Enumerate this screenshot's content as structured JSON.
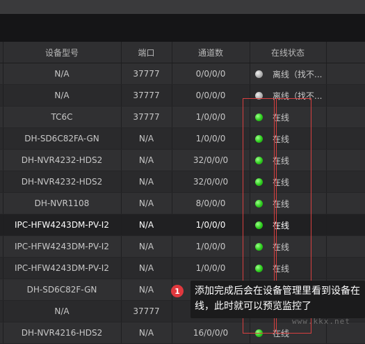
{
  "columns": [
    "设备型号",
    "端口",
    "通道数",
    "在线状态"
  ],
  "rows": [
    {
      "model": "N/A",
      "port": "37777",
      "channels": "0/0/0/0",
      "status": "离线（找不...",
      "online": false
    },
    {
      "model": "N/A",
      "port": "37777",
      "channels": "0/0/0/0",
      "status": "离线（找不...",
      "online": false
    },
    {
      "model": "TC6C",
      "port": "37777",
      "channels": "1/0/0/0",
      "status": "在线",
      "online": true
    },
    {
      "model": "DH-SD6C82FA-GN",
      "port": "N/A",
      "channels": "1/0/0/0",
      "status": "在线",
      "online": true
    },
    {
      "model": "DH-NVR4232-HDS2",
      "port": "N/A",
      "channels": "32/0/0/0",
      "status": "在线",
      "online": true
    },
    {
      "model": "DH-NVR4232-HDS2",
      "port": "N/A",
      "channels": "32/0/0/0",
      "status": "在线",
      "online": true
    },
    {
      "model": "DH-NVR1108",
      "port": "N/A",
      "channels": "8/0/0/0",
      "status": "在线",
      "online": true
    },
    {
      "model": "IPC-HFW4243DM-PV-I2",
      "port": "N/A",
      "channels": "1/0/0/0",
      "status": "在线",
      "online": true,
      "selected": true
    },
    {
      "model": "IPC-HFW4243DM-PV-I2",
      "port": "N/A",
      "channels": "1/0/0/0",
      "status": "在线",
      "online": true
    },
    {
      "model": "IPC-HFW4243DM-PV-I2",
      "port": "N/A",
      "channels": "1/0/0/0",
      "status": "在线",
      "online": true
    },
    {
      "model": "DH-SD6C82F-GN",
      "port": "N/A",
      "channels": "1/0/0/0",
      "status": "在线",
      "online": true
    },
    {
      "model": "N/A",
      "port": "37777",
      "channels": "",
      "status": "",
      "online": true
    },
    {
      "model": "DH-NVR4216-HDS2",
      "port": "N/A",
      "channels": "16/0/0/0",
      "status": "在线",
      "online": true
    }
  ],
  "tooltip": {
    "badge": "1",
    "text": "添加完成后会在设备管理里看到设备在线，此时就可以预览监控了"
  },
  "watermark": "www.kkx.net",
  "colors": {
    "online": "#2ecc1e",
    "offline": "#aaaaaa",
    "highlight": "#d94040",
    "badge": "#e0383e"
  }
}
